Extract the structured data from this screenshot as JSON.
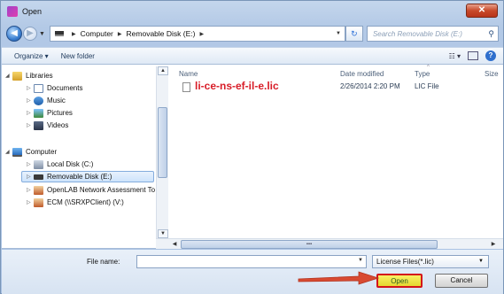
{
  "window": {
    "title": "Open",
    "close": "✕"
  },
  "address": {
    "crumbs": [
      "Computer",
      "Removable Disk (E:)"
    ],
    "search_placeholder": "Search Removable Disk (E:)"
  },
  "toolbar": {
    "organize": "Organize ▾",
    "new_folder": "New folder",
    "views": "☷ ▾",
    "help": "?"
  },
  "nav": {
    "items": [
      {
        "label": "Libraries",
        "icon": "library-icon",
        "toggle": "◢"
      },
      {
        "label": "Documents",
        "icon": "documents-icon",
        "toggle": "▷"
      },
      {
        "label": "Music",
        "icon": "music-icon",
        "toggle": "▷"
      },
      {
        "label": "Pictures",
        "icon": "pictures-icon",
        "toggle": "▷"
      },
      {
        "label": "Videos",
        "icon": "videos-icon",
        "toggle": "▷"
      },
      {
        "label": "Computer",
        "icon": "computer-icon",
        "toggle": "◢"
      },
      {
        "label": "Local Disk (C:)",
        "icon": "hard-disk-icon",
        "toggle": "▷"
      },
      {
        "label": "Removable Disk (E:)",
        "icon": "usb-drive-icon",
        "toggle": "▷"
      },
      {
        "label": "OpenLAB Network Assessment To",
        "icon": "network-drive-icon",
        "toggle": "▷"
      },
      {
        "label": "ECM (\\\\SRXPClient) (V:)",
        "icon": "network-drive-icon",
        "toggle": "▷"
      }
    ]
  },
  "columns": {
    "name": "Name",
    "date": "Date modified",
    "type": "Type",
    "size": "Size"
  },
  "files": [
    {
      "name": "li-ce-ns-ef-il-e.lic",
      "date": "2/26/2014 2:20 PM",
      "type": "LIC File"
    }
  ],
  "bottom": {
    "filename_label": "File name:",
    "filename_value": "",
    "filter": "License Files(*.lic)",
    "open": "Open",
    "cancel": "Cancel"
  },
  "colors": {
    "highlight": "#d4141a",
    "open_fill": "#f9f266"
  }
}
